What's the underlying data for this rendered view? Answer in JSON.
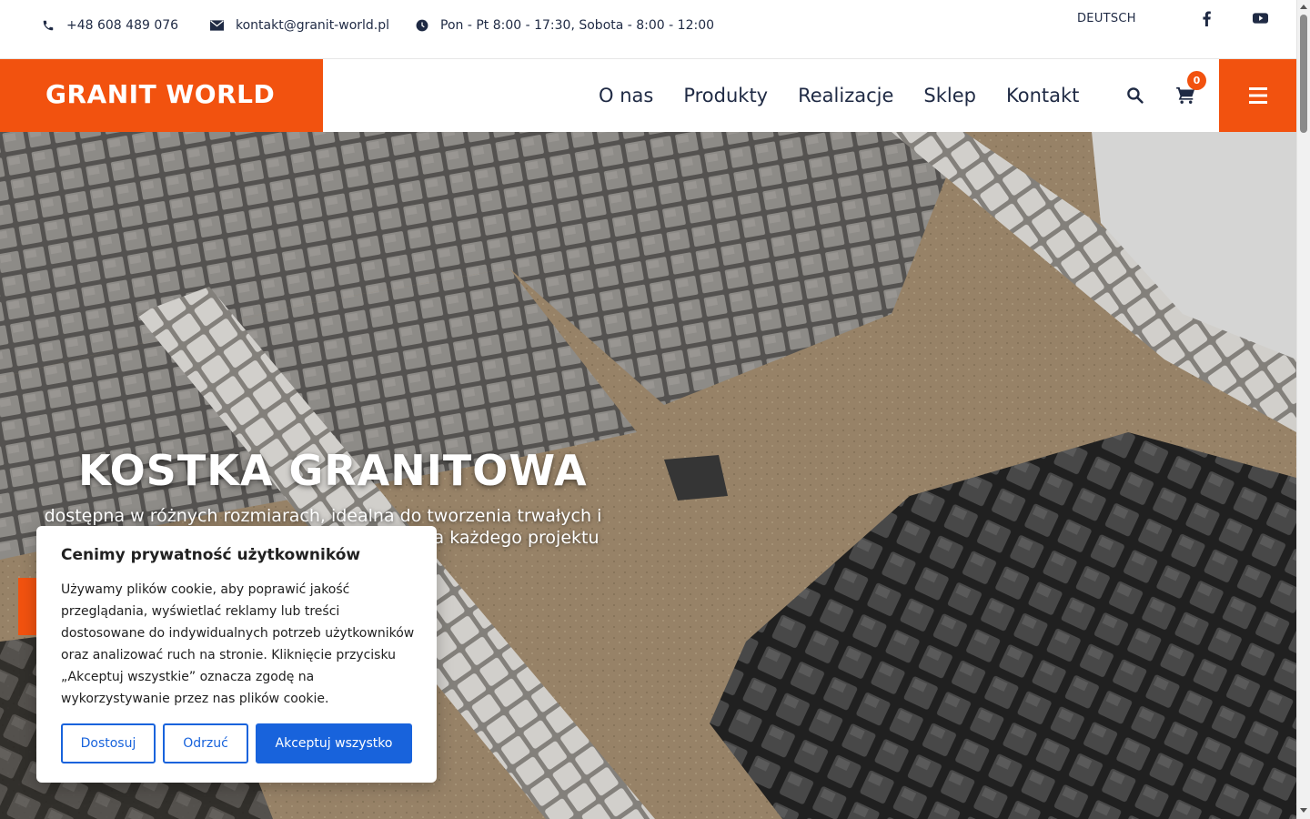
{
  "topbar": {
    "phone": "+48 608 489 076",
    "email": "kontakt@granit-world.pl",
    "hours": "Pon - Pt 8:00 - 17:30, Sobota - 8:00 - 12:00",
    "language": "DEUTSCH",
    "icons": [
      "phone-icon",
      "envelope-icon",
      "clock-icon",
      "facebook-icon",
      "youtube-icon"
    ]
  },
  "nav": {
    "logo": "GRANIT WORLD",
    "links": [
      "O nas",
      "Produkty",
      "Realizacje",
      "Sklep",
      "Kontakt"
    ],
    "cart_count": "0",
    "icons": [
      "search-icon",
      "cart-icon",
      "hamburger-menu-icon"
    ]
  },
  "hero": {
    "title": "KOSTKA GRANITOWA",
    "subtitle": "dostępna w różnych rozmiarach, idealna do tworzenia trwałych i estetycznych nawierzchni. Sprawdź ofertę dla każdego projektu"
  },
  "cookie": {
    "title": "Cenimy prywatność użytkowników",
    "text": "Używamy plików cookie, aby poprawić jakość przeglądania, wyświetlać reklamy lub treści dostosowane do indywidualnych potrzeb użytkowników oraz analizować ruch na stronie. Kliknięcie przycisku „Akceptuj wszystkie” oznacza zgodę na wykorzystywanie przez nas plików cookie.",
    "customize": "Dostosuj",
    "reject": "Odrzuć",
    "accept": "Akceptuj wszystko"
  },
  "colors": {
    "accent": "#f2520f",
    "navy": "#1f2a44",
    "cookie_blue": "#1863dc"
  }
}
